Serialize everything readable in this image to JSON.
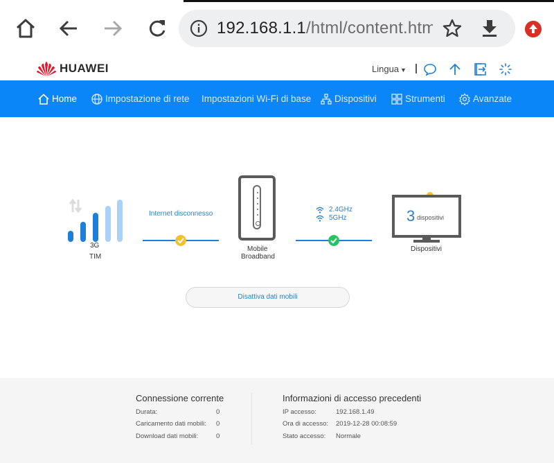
{
  "browser": {
    "url_host": "192.168.1.1",
    "url_path": "/html/content.html"
  },
  "header": {
    "brand": "HUAWEI",
    "language_label": "Lingua"
  },
  "nav": {
    "items": [
      {
        "label": "Home",
        "icon": "home-icon",
        "active": true
      },
      {
        "label": "Impostazione di rete",
        "icon": "globe-icon",
        "active": false
      },
      {
        "label": "Impostazioni Wi-Fi di base",
        "icon": "",
        "active": false
      },
      {
        "label": "Dispositivi",
        "icon": "network-icon",
        "active": false
      },
      {
        "label": "Strumenti",
        "icon": "grid-icon",
        "active": false
      },
      {
        "label": "Avanzate",
        "icon": "gear-icon",
        "active": false
      }
    ]
  },
  "topology": {
    "network_type": "3G",
    "operator": "TIM",
    "internet_status": "Internet disconnesso",
    "router_label_line1": "Mobile",
    "router_label_line2": "Broadband",
    "wifi_band_1": "2.4GHz",
    "wifi_band_2": "5GHz",
    "device_count": "3",
    "device_count_label": "dispositivi",
    "devices_label": "Dispositivi",
    "mobile_data_button": "Disattiva dati mobili"
  },
  "current_connection": {
    "title": "Connessione corrente",
    "rows": [
      {
        "label": "Durata:",
        "value": "0"
      },
      {
        "label": "Caricamento dati mobili:",
        "value": "0"
      },
      {
        "label": "Download dati mobili:",
        "value": "0"
      }
    ]
  },
  "previous_access": {
    "title": "Informazioni di accesso precedenti",
    "rows": [
      {
        "label": "IP accesso:",
        "value": "192.168.1.49"
      },
      {
        "label": "Ora di accesso:",
        "value": "2019-12-28 00:08:59"
      },
      {
        "label": "Stato accesso:",
        "value": "Normale"
      }
    ]
  },
  "colors": {
    "nav_blue": "#0b86f8",
    "signal_blue": "#1e7fd8",
    "warning_yellow": "#f2c12e",
    "ok_green": "#23c45e"
  }
}
